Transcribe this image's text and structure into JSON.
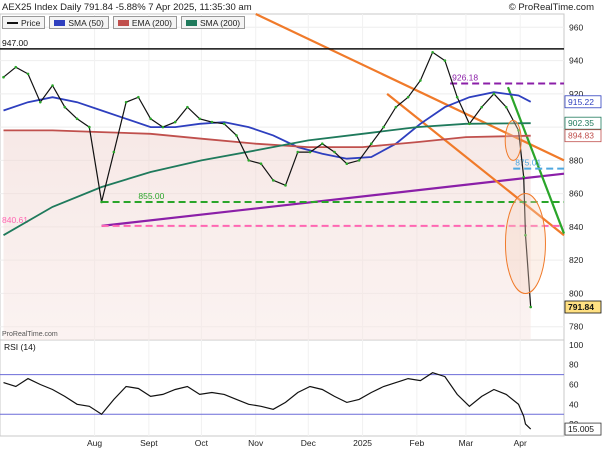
{
  "header": {
    "title": "AEX25 Index Daily 791.84 -5.88% 7 Apr 2025, 11:35:30 am",
    "brand": "© ProRealTime.com",
    "watermark": "ProRealTime.com"
  },
  "legend": [
    {
      "label": "Price",
      "color": "#111111"
    },
    {
      "label": "SMA (50)",
      "color": "#2e3fbf"
    },
    {
      "label": "EMA (200)",
      "color": "#c0504d"
    },
    {
      "label": "SMA (200)",
      "color": "#1f7a5c"
    }
  ],
  "chart_data": [
    {
      "type": "line",
      "panel": "price",
      "ylim": [
        772,
        968
      ],
      "y_ticks": [
        780,
        800,
        820,
        840,
        860,
        880,
        900,
        920,
        940,
        960
      ],
      "x_ticks": [
        {
          "label": "Aug",
          "x": "2024-08-01"
        },
        {
          "label": "Sept",
          "x": "2024-09-01"
        },
        {
          "label": "Oct",
          "x": "2024-10-01"
        },
        {
          "label": "Nov",
          "x": "2024-11-01"
        },
        {
          "label": "Dec",
          "x": "2024-12-01"
        },
        {
          "label": "2025",
          "x": "2025-01-01"
        },
        {
          "label": "Feb",
          "x": "2025-02-01"
        },
        {
          "label": "Mar",
          "x": "2025-03-01"
        },
        {
          "label": "Apr",
          "x": "2025-04-01"
        }
      ],
      "xlim": [
        "2024-06-08",
        "2025-04-26"
      ],
      "series": [
        {
          "name": "Price",
          "color": "#111111",
          "points": [
            [
              "2024-06-10",
              930
            ],
            [
              "2024-06-17",
              936
            ],
            [
              "2024-06-24",
              932
            ],
            [
              "2024-07-01",
              915
            ],
            [
              "2024-07-08",
              925
            ],
            [
              "2024-07-15",
              912
            ],
            [
              "2024-07-22",
              905
            ],
            [
              "2024-07-29",
              900
            ],
            [
              "2024-08-05",
              855
            ],
            [
              "2024-08-12",
              885
            ],
            [
              "2024-08-19",
              915
            ],
            [
              "2024-08-26",
              918
            ],
            [
              "2024-09-02",
              905
            ],
            [
              "2024-09-09",
              900
            ],
            [
              "2024-09-16",
              903
            ],
            [
              "2024-09-23",
              912
            ],
            [
              "2024-09-30",
              905
            ],
            [
              "2024-10-07",
              903
            ],
            [
              "2024-10-14",
              902
            ],
            [
              "2024-10-21",
              895
            ],
            [
              "2024-10-28",
              880
            ],
            [
              "2024-11-04",
              878
            ],
            [
              "2024-11-11",
              868
            ],
            [
              "2024-11-18",
              865
            ],
            [
              "2024-11-25",
              885
            ],
            [
              "2024-12-02",
              885
            ],
            [
              "2024-12-09",
              890
            ],
            [
              "2024-12-16",
              885
            ],
            [
              "2024-12-23",
              878
            ],
            [
              "2024-12-30",
              880
            ],
            [
              "2025-01-06",
              890
            ],
            [
              "2025-01-13",
              900
            ],
            [
              "2025-01-20",
              912
            ],
            [
              "2025-01-27",
              918
            ],
            [
              "2025-02-03",
              928
            ],
            [
              "2025-02-10",
              945
            ],
            [
              "2025-02-17",
              940
            ],
            [
              "2025-02-24",
              918
            ],
            [
              "2025-03-03",
              902
            ],
            [
              "2025-03-10",
              912
            ],
            [
              "2025-03-17",
              920
            ],
            [
              "2025-03-24",
              912
            ],
            [
              "2025-03-31",
              898
            ],
            [
              "2025-04-03",
              870
            ],
            [
              "2025-04-04",
              835
            ],
            [
              "2025-04-07",
              791.84
            ]
          ]
        },
        {
          "name": "SMA (50)",
          "color": "#2e3fbf",
          "points": [
            [
              "2024-06-10",
              910
            ],
            [
              "2024-06-24",
              915
            ],
            [
              "2024-07-08",
              918
            ],
            [
              "2024-07-22",
              915
            ],
            [
              "2024-08-05",
              910
            ],
            [
              "2024-08-19",
              905
            ],
            [
              "2024-09-02",
              900
            ],
            [
              "2024-09-16",
              900
            ],
            [
              "2024-09-30",
              902
            ],
            [
              "2024-10-14",
              903
            ],
            [
              "2024-10-28",
              900
            ],
            [
              "2024-11-11",
              895
            ],
            [
              "2024-11-25",
              888
            ],
            [
              "2024-12-09",
              884
            ],
            [
              "2024-12-23",
              881
            ],
            [
              "2025-01-06",
              882
            ],
            [
              "2025-01-20",
              890
            ],
            [
              "2025-02-03",
              902
            ],
            [
              "2025-02-17",
              912
            ],
            [
              "2025-03-03",
              918
            ],
            [
              "2025-03-17",
              921
            ],
            [
              "2025-03-31",
              919
            ],
            [
              "2025-04-07",
              915.22
            ]
          ]
        },
        {
          "name": "EMA (200)",
          "color": "#c0504d",
          "points": [
            [
              "2024-06-10",
              898
            ],
            [
              "2024-07-08",
              898
            ],
            [
              "2024-08-05",
              897
            ],
            [
              "2024-09-02",
              896
            ],
            [
              "2024-10-01",
              893
            ],
            [
              "2024-11-01",
              890
            ],
            [
              "2024-12-01",
              888
            ],
            [
              "2025-01-01",
              888
            ],
            [
              "2025-02-01",
              891
            ],
            [
              "2025-03-01",
              894
            ],
            [
              "2025-04-07",
              894.83
            ]
          ]
        },
        {
          "name": "SMA (200)",
          "color": "#1f7a5c",
          "points": [
            [
              "2024-06-10",
              835
            ],
            [
              "2024-07-08",
              852
            ],
            [
              "2024-08-05",
              864
            ],
            [
              "2024-09-02",
              873
            ],
            [
              "2024-10-01",
              880
            ],
            [
              "2024-11-01",
              886
            ],
            [
              "2024-12-01",
              892
            ],
            [
              "2025-01-01",
              896
            ],
            [
              "2025-02-01",
              900
            ],
            [
              "2025-03-01",
              902
            ],
            [
              "2025-04-07",
              902.35
            ]
          ]
        }
      ],
      "levels": [
        {
          "label": "947.00",
          "value": 947,
          "color": "#111111"
        },
        {
          "label": "926.18",
          "value": 926.18,
          "color": "#8b1fa8"
        },
        {
          "label": "855.00",
          "value": 855,
          "color": "#2aa52a"
        },
        {
          "label": "840.61",
          "value": 840.61,
          "color": "#ff66b3"
        },
        {
          "label": "875.01",
          "value": 875.01,
          "color": "#4fa8e0"
        }
      ],
      "trendlines": [
        {
          "name": "purple-support",
          "color": "#8b1fa8",
          "from": [
            "2024-08-05",
            840.61
          ],
          "to": [
            "2025-04-26",
            872
          ]
        },
        {
          "name": "orange-upper-channel",
          "color": "#f07a2a",
          "from": [
            "2024-11-01",
            968
          ],
          "to": [
            "2025-04-26",
            880
          ]
        },
        {
          "name": "orange-lower-channel",
          "color": "#f07a2a",
          "from": [
            "2025-01-15",
            920
          ],
          "to": [
            "2025-04-26",
            835
          ]
        },
        {
          "name": "green-downtrend",
          "color": "#2aa52a",
          "from": [
            "2025-03-25",
            924
          ],
          "to": [
            "2025-04-26",
            836
          ]
        }
      ],
      "price_labels": [
        {
          "value": "915.22",
          "color": "#2e3fbf"
        },
        {
          "value": "902.35",
          "color": "#1f7a5c"
        },
        {
          "value": "894.83",
          "color": "#c0504d"
        },
        {
          "value": "791.84",
          "color": "#111111",
          "highlight": "#ffe082"
        }
      ]
    },
    {
      "type": "line",
      "panel": "rsi",
      "title": "RSI (14)",
      "ylim": [
        8,
        105
      ],
      "y_ticks": [
        20,
        40,
        60,
        80,
        100
      ],
      "bands": [
        30,
        70
      ],
      "last_value": "15.005",
      "series": [
        {
          "name": "RSI (14)",
          "color": "#111111",
          "points": [
            [
              "2024-06-10",
              62
            ],
            [
              "2024-06-17",
              58
            ],
            [
              "2024-06-24",
              66
            ],
            [
              "2024-07-01",
              60
            ],
            [
              "2024-07-08",
              55
            ],
            [
              "2024-07-15",
              48
            ],
            [
              "2024-07-22",
              40
            ],
            [
              "2024-07-29",
              38
            ],
            [
              "2024-08-05",
              30
            ],
            [
              "2024-08-12",
              45
            ],
            [
              "2024-08-19",
              58
            ],
            [
              "2024-08-26",
              56
            ],
            [
              "2024-09-02",
              48
            ],
            [
              "2024-09-09",
              50
            ],
            [
              "2024-09-16",
              55
            ],
            [
              "2024-09-23",
              58
            ],
            [
              "2024-09-30",
              50
            ],
            [
              "2024-10-07",
              52
            ],
            [
              "2024-10-14",
              50
            ],
            [
              "2024-10-21",
              45
            ],
            [
              "2024-10-28",
              40
            ],
            [
              "2024-11-04",
              38
            ],
            [
              "2024-11-11",
              35
            ],
            [
              "2024-11-18",
              42
            ],
            [
              "2024-11-25",
              52
            ],
            [
              "2024-12-02",
              58
            ],
            [
              "2024-12-09",
              55
            ],
            [
              "2024-12-16",
              48
            ],
            [
              "2024-12-23",
              42
            ],
            [
              "2024-12-30",
              45
            ],
            [
              "2025-01-06",
              52
            ],
            [
              "2025-01-13",
              58
            ],
            [
              "2025-01-20",
              62
            ],
            [
              "2025-01-27",
              66
            ],
            [
              "2025-02-03",
              64
            ],
            [
              "2025-02-10",
              72
            ],
            [
              "2025-02-17",
              68
            ],
            [
              "2025-02-24",
              50
            ],
            [
              "2025-03-03",
              38
            ],
            [
              "2025-03-10",
              48
            ],
            [
              "2025-03-17",
              55
            ],
            [
              "2025-03-24",
              50
            ],
            [
              "2025-03-31",
              40
            ],
            [
              "2025-04-03",
              28
            ],
            [
              "2025-04-04",
              20
            ],
            [
              "2025-04-07",
              15.005
            ]
          ]
        }
      ]
    }
  ]
}
